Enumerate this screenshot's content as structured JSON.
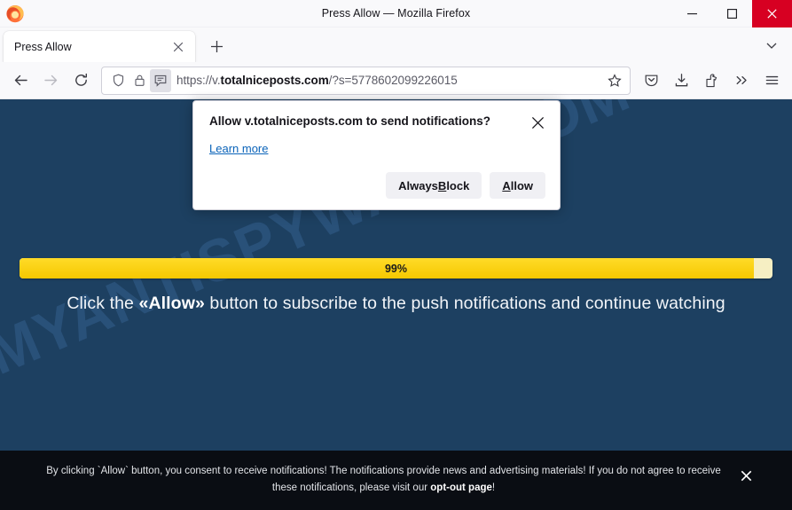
{
  "window": {
    "title": "Press Allow — Mozilla Firefox",
    "app_icon": "firefox-logo-icon",
    "minimize_label": "Minimize",
    "maximize_label": "Maximize",
    "close_label": "Close"
  },
  "tabs": {
    "items": [
      {
        "title": "Press Allow",
        "close_label": "Close tab"
      }
    ],
    "new_tab_label": "New tab",
    "list_all_label": "List all tabs"
  },
  "toolbar": {
    "back_label": "Go back one page",
    "forward_label": "Go forward one page",
    "reload_label": "Reload current page",
    "shield_label": "tracking-protection-shield-icon",
    "lock_label": "connection-lock-icon",
    "permission_label": "notification-permission-icon",
    "bookmark_label": "Bookmark this page",
    "pocket_label": "Save to Pocket",
    "downloads_label": "Downloads",
    "account_label": "Account",
    "overflow_label": "More tools",
    "menu_label": "Open application menu"
  },
  "url": {
    "scheme": "https://",
    "subdomain": "v.",
    "host": "totalniceposts.com",
    "path": "/?s=5778602099226015",
    "full": "https://v.totalniceposts.com/?s=5778602099226015"
  },
  "doorhanger": {
    "title": "Allow v.totalniceposts.com to send notifications?",
    "close_label": "Close",
    "learn_more": "Learn more",
    "block_button": {
      "prefix": "Always ",
      "accesskey": "B",
      "suffix": "lock"
    },
    "allow_button": {
      "prefix": "",
      "accesskey": "A",
      "suffix": "llow"
    }
  },
  "page": {
    "background_color": "#1d4061",
    "watermark_text": "MYANTISPYWARE.COM",
    "progress": {
      "percent_label": "99%",
      "percent_value": 99,
      "fill_color": "#ffd21a",
      "track_color": "#f6efc3"
    },
    "headline": {
      "before": "Click the ",
      "emphasis": "«Allow»",
      "after": " button to subscribe to the push notifications and continue watching"
    }
  },
  "consent_banner": {
    "background_color": "#0a0d13",
    "text_part1": "By clicking `Allow` button, you consent to receive notifications! The notifications provide news and advertising materials! If you do not agree to receive these notifications, please visit our ",
    "link_text": "opt-out page",
    "text_part2": "!",
    "close_label": "✕"
  }
}
